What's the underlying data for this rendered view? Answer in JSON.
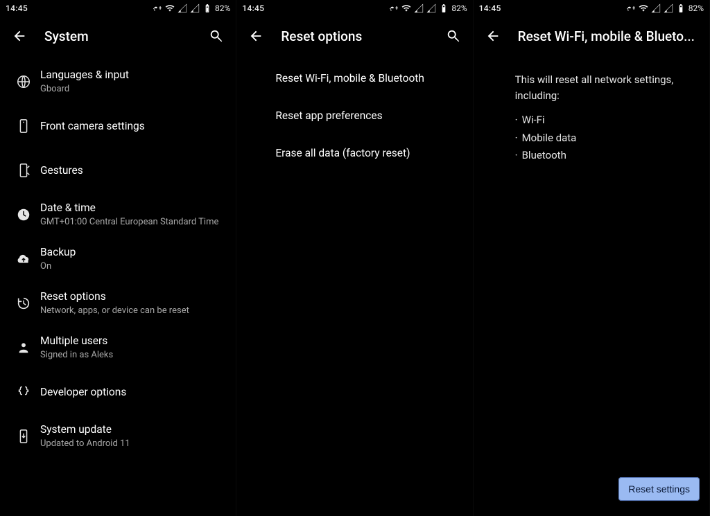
{
  "status": {
    "time": "14:45",
    "battery": "82%"
  },
  "panel1": {
    "title": "System",
    "items": [
      {
        "title": "Languages & input",
        "sub": "Gboard"
      },
      {
        "title": "Front camera settings",
        "sub": ""
      },
      {
        "title": "Gestures",
        "sub": ""
      },
      {
        "title": "Date & time",
        "sub": "GMT+01:00 Central European Standard Time"
      },
      {
        "title": "Backup",
        "sub": "On"
      },
      {
        "title": "Reset options",
        "sub": "Network, apps, or device can be reset"
      },
      {
        "title": "Multiple users",
        "sub": "Signed in as Aleks"
      },
      {
        "title": "Developer options",
        "sub": ""
      },
      {
        "title": "System update",
        "sub": "Updated to Android 11"
      }
    ]
  },
  "panel2": {
    "title": "Reset options",
    "items": [
      "Reset Wi-Fi, mobile & Bluetooth",
      "Reset app preferences",
      "Erase all data (factory reset)"
    ]
  },
  "panel3": {
    "title": "Reset Wi-Fi, mobile & Blueto...",
    "description": "This will reset all network settings, including:",
    "bullets": [
      "Wi-Fi",
      "Mobile data",
      "Bluetooth"
    ],
    "action": "Reset settings"
  }
}
